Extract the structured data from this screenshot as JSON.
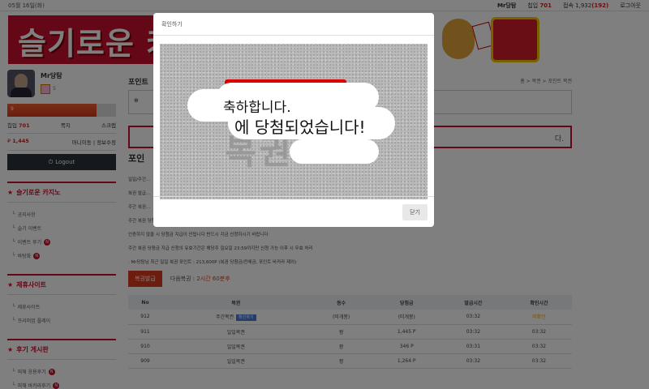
{
  "topbar": {
    "date": "05월 16일(화)",
    "user": "Mr당탐",
    "points_label": "칩입",
    "points": "701",
    "online_label": "접속",
    "online": "1,932",
    "online_paren": "(192)",
    "logout": "로그아웃"
  },
  "banner": {
    "title": "슬기로운 카"
  },
  "sidebar": {
    "name": "Mr당탐",
    "level": "5",
    "exp_text": "9",
    "exp_fraction": 0.82,
    "points_label": "칩입",
    "points": "701",
    "tab2": "쪽지",
    "tab3": "스크랩",
    "money": "1,445",
    "change": "머니이동",
    "info": "정보수정",
    "logout": "Logout",
    "sections": [
      {
        "title": "슬기로운 카지노",
        "items": [
          "공지사항",
          "슬기 이벤트",
          "이벤트 후기",
          "바탕화"
        ]
      },
      {
        "title": "제휴사이트",
        "items": [
          "제휴사이트",
          "프리미엄 플레이"
        ]
      },
      {
        "title": "후기 게시판",
        "items": [
          "피해 응용후기",
          "피해 바카라후기"
        ]
      }
    ]
  },
  "main": {
    "crumb": "홈 > 복권 > 포인트 복권",
    "title": "포인트",
    "box2_text": "다.",
    "lotto_title": "포인",
    "lines": [
      "일일/주간...",
      "복권 발급...",
      "주간 복권...",
      "주간 복권 당첨 시에 자동처리 되며 당첨 후 본 스레드로 인증하시기 바랍니다",
      "인증하지 않을 시 당첨금 지급이 안됩니다 반드시 지금 신청하시기 바랍니다",
      "주간 복권 당첨금 지급 신청의 유효기간은 해당주 일요일 23:59까지만 신청 가능 이후 시 무효 처리",
      "· Mr당탐님 최근 일일 복권 포인트 : 213,600P (복권 당첨금/전체금, 포인트 바카라 제외)"
    ],
    "issue_btn": "복권발급",
    "next_label": "다음복권 :",
    "next_value": "2시간 60분후",
    "table": {
      "headers": [
        "No",
        "복권",
        "등수",
        "당첨금",
        "발급시간",
        "확인시간"
      ],
      "rows": [
        [
          "912",
          "주간복권",
          "(미개봉)",
          "(미개봉)",
          "03:32",
          "미확인"
        ],
        [
          "911",
          "일일복권",
          "꽝",
          "1,445 P",
          "03:32",
          "03:32"
        ],
        [
          "910",
          "일일복권",
          "꽝",
          "346 P",
          "03:31",
          "03:32"
        ],
        [
          "909",
          "일일복권",
          "꽝",
          "1,264 P",
          "03:32",
          "03:32"
        ]
      ],
      "tag": "확인하기"
    }
  },
  "modal": {
    "title": "확인하기",
    "line1": "축하합니다.",
    "line2": "에 당첨되었습니다!",
    "bg_text": "복권",
    "close": "닫기"
  }
}
